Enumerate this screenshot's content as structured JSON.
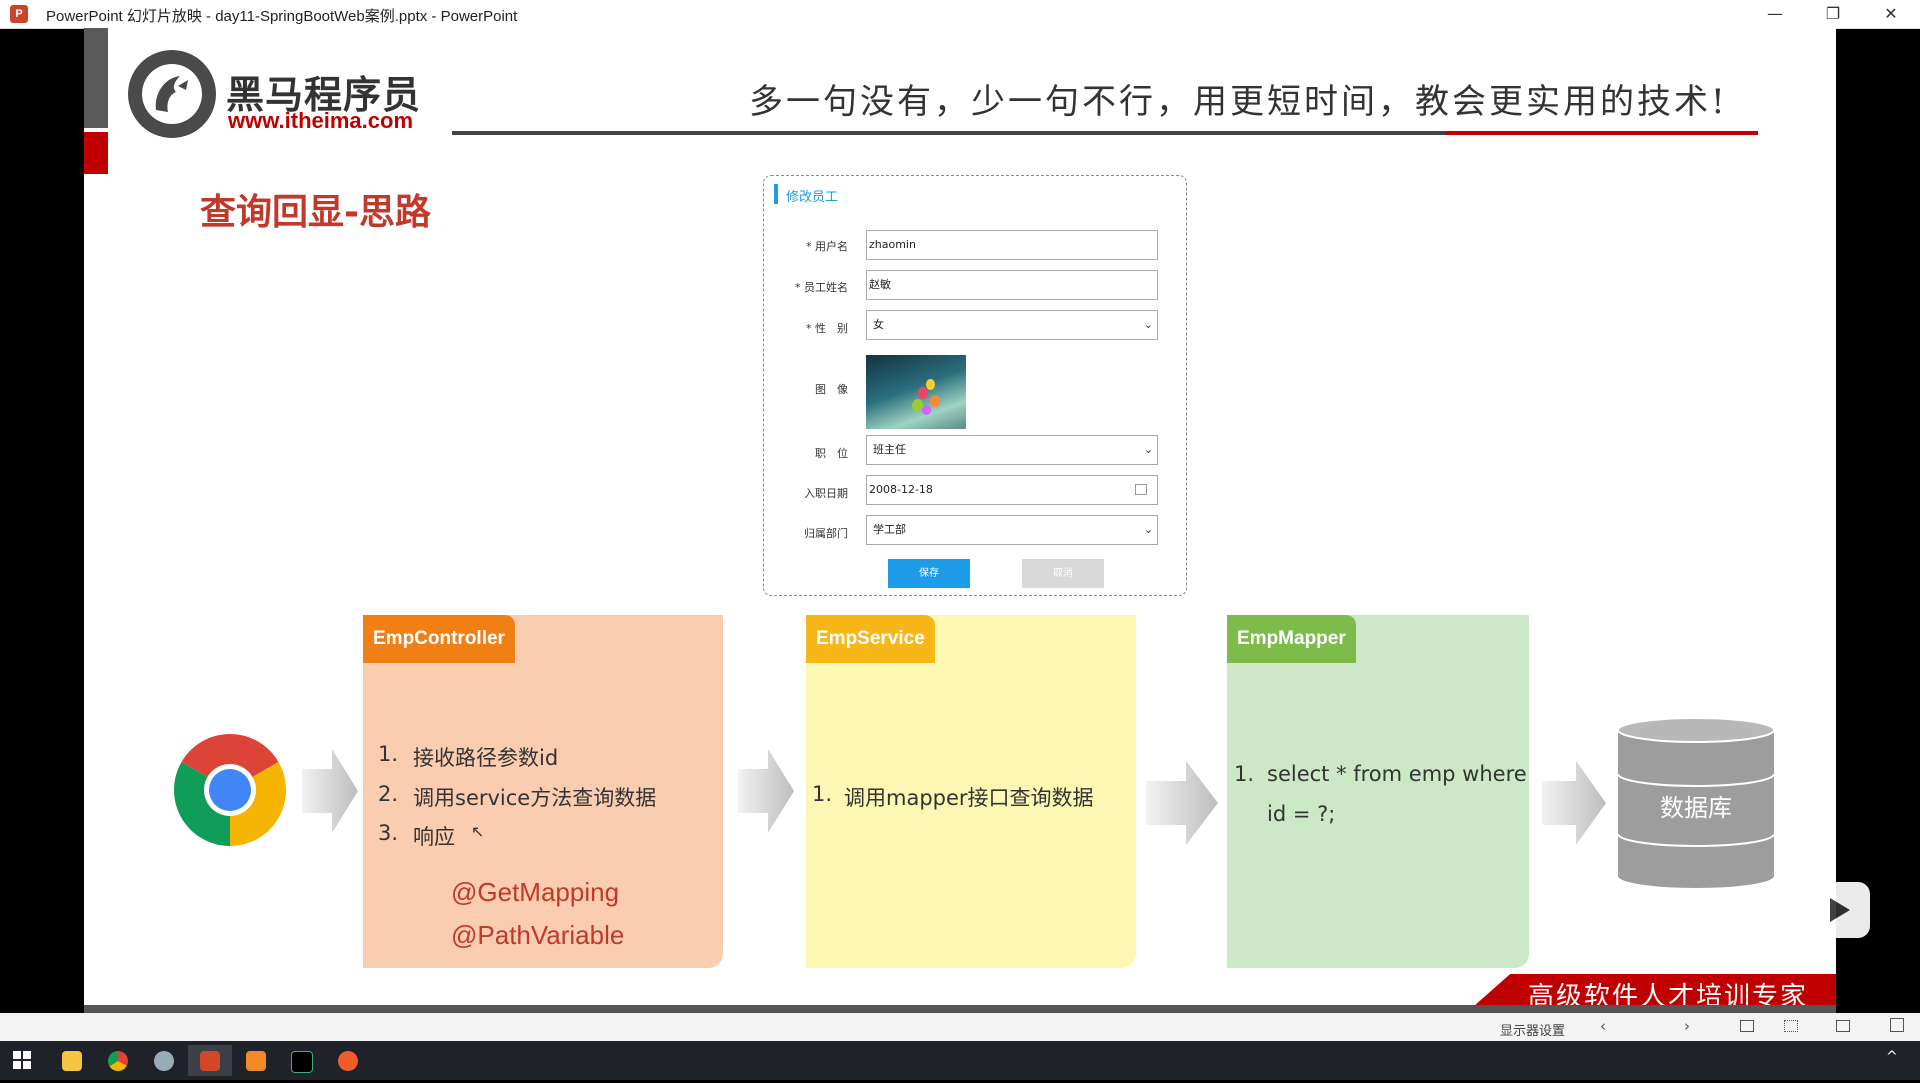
{
  "window": {
    "title": "PowerPoint 幻灯片放映 - day11-SpringBootWeb案例.pptx - PowerPoint",
    "app_icon": "P",
    "minimize": "—",
    "restore": "❐",
    "close": "✕"
  },
  "header": {
    "logo_name": "黑马程序员",
    "logo_url": "www.itheima.com",
    "slogan": "多一句没有，少一句不行，用更短时间，教会更实用的技术!"
  },
  "slide_title": "查询回显-思路",
  "form": {
    "title": "修改员工",
    "fields": {
      "username": {
        "label": "* 用户名",
        "value": "zhaomin"
      },
      "name": {
        "label": "* 员工姓名",
        "value": "赵敏"
      },
      "gender": {
        "label": "* 性　别",
        "value": "女"
      },
      "image": {
        "label": "图　像"
      },
      "job": {
        "label": "职　位",
        "value": "班主任"
      },
      "entrydate": {
        "label": "入职日期",
        "value": "2008-12-18"
      },
      "dept": {
        "label": "归属部门",
        "value": "学工部"
      }
    },
    "save": "保存",
    "cancel": "取消"
  },
  "flow": {
    "controller": {
      "title": "EmpController",
      "items": [
        "1.",
        "接收路径参数id",
        "2.",
        "调用service方法查询数据",
        "3.",
        "响应"
      ],
      "annotations": [
        "@GetMapping",
        "@PathVariable"
      ],
      "color": "#f08015",
      "bg": "#fbcdb0"
    },
    "service": {
      "title": "EmpService",
      "items": [
        "1.",
        "调用mapper接口查询数据"
      ],
      "color": "#f7b718",
      "bg": "#fcf8b3"
    },
    "mapper": {
      "title": "EmpMapper",
      "items": [
        "1.",
        "select * from emp where",
        "id = ?;"
      ],
      "color": "#7dbb4a",
      "bg": "#cde8c6"
    },
    "database": "数据库"
  },
  "footer": {
    "banner": "高级软件人才培训专家",
    "display_settings": "显示器设置"
  },
  "icons": [
    "powerpoint-icon",
    "chrome-icon",
    "database-icon",
    "windows-icon",
    "folder-icon",
    "intellij-icon",
    "play-icon"
  ]
}
